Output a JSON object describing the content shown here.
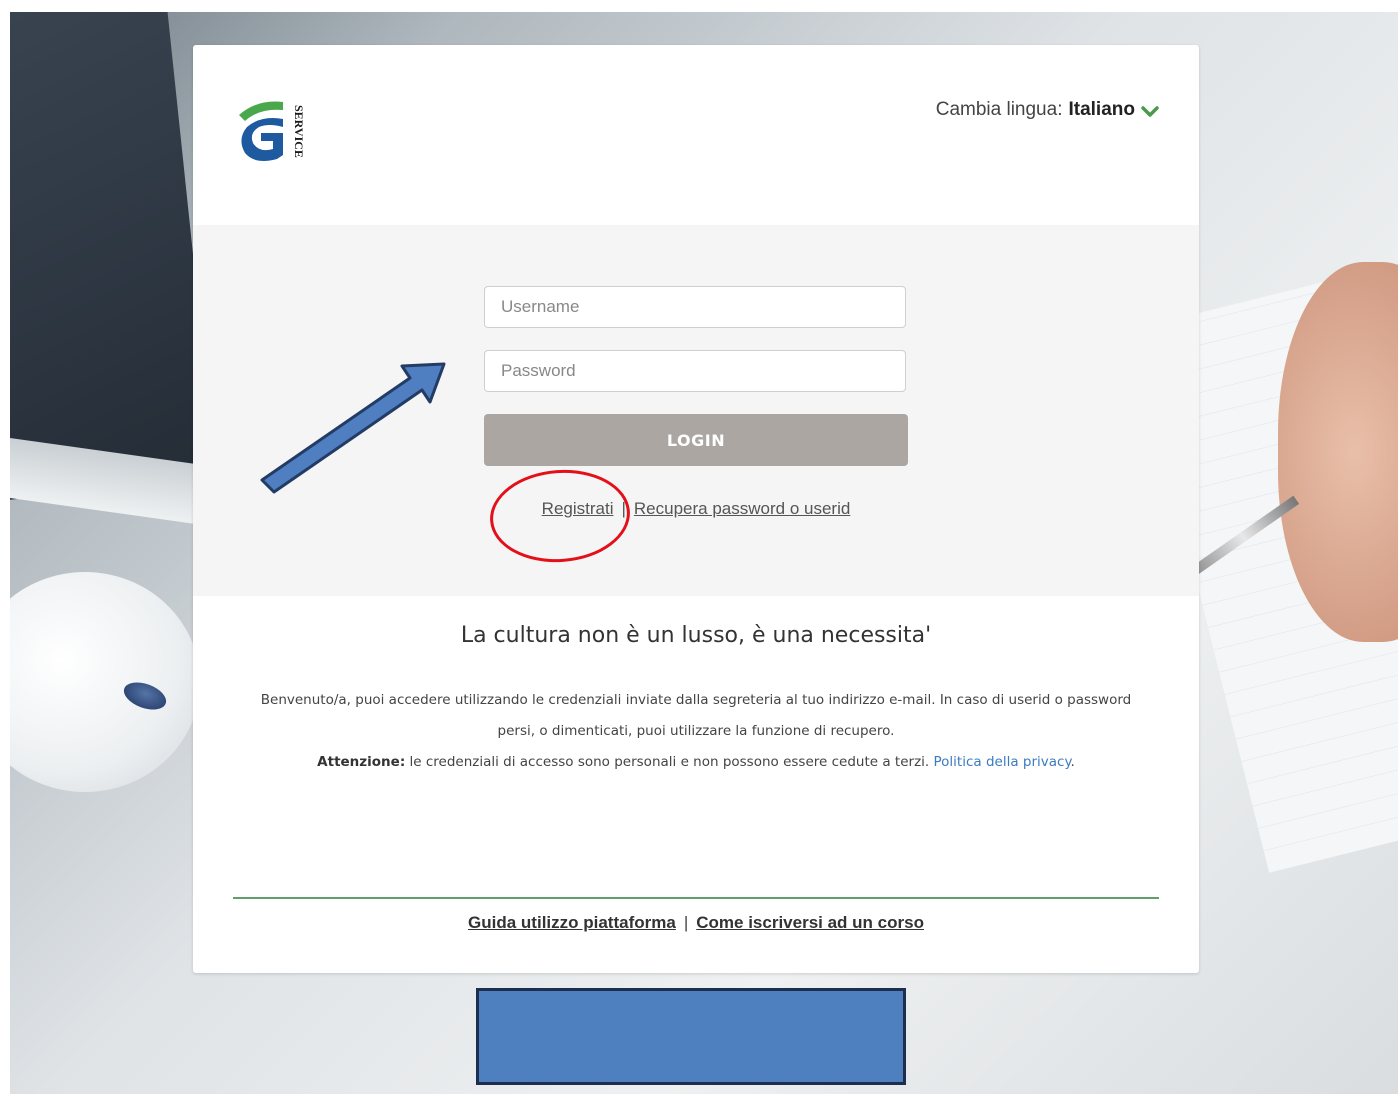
{
  "header": {
    "logo_text": "SERVICE",
    "lang_label": "Cambia lingua:",
    "lang_value": "Italiano"
  },
  "login": {
    "username_placeholder": "Username",
    "password_placeholder": "Password",
    "login_label": "LOGIN",
    "register_label": "Registrati",
    "separator": "|",
    "recover_label": "Recupera password o userid"
  },
  "tagline": "La cultura non è un lusso, è una necessita'",
  "info": {
    "welcome": "Benvenuto/a, puoi accedere utilizzando le credenziali inviate dalla segreteria al tuo indirizzo e-mail. In caso di userid o password persi, o dimenticati, puoi utilizzare la funzione di recupero.",
    "attention_label": "Attenzione:",
    "attention_text": " le credenziali di accesso sono personali e non possono essere cedute a terzi. ",
    "privacy_label": "Politica della privacy",
    "period": "."
  },
  "footer": {
    "guide_label": "Guida utilizzo piattaforma",
    "separator": "|",
    "howto_label": "Come iscriversi ad un corso"
  },
  "colors": {
    "accent_green": "#4a9a4e",
    "login_button": "#aca6a2",
    "privacy_link": "#3d7bbf",
    "annotation_red": "#e3101a",
    "annotation_blue": "#4e7fbe"
  },
  "icons": [
    "logo-icon",
    "chevron-down-icon",
    "annotation-arrow-icon"
  ]
}
